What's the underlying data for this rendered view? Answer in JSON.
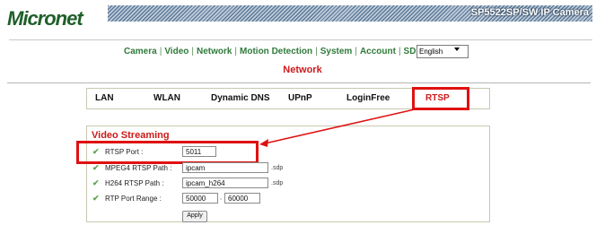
{
  "header": {
    "logo_text": "Micronet",
    "product_title": "SP5522SP/SW IP Camera"
  },
  "nav": {
    "items": [
      "Camera",
      "Video",
      "Network",
      "Motion Detection",
      "System",
      "Account",
      "SDHC"
    ],
    "separator": "|",
    "language_value": "English"
  },
  "page_title": "Network",
  "tabs": {
    "items": [
      "LAN",
      "WLAN",
      "Dynamic DNS",
      "UPnP",
      "LoginFree",
      "RTSP"
    ],
    "active": "RTSP"
  },
  "section": {
    "title": "Video Streaming",
    "rtsp_port_label": "RTSP Port :",
    "rtsp_port_value": "5011",
    "mpeg4_label": "MPEG4 RTSP Path :",
    "mpeg4_value": "ipcam",
    "mpeg4_suffix": ".sdp",
    "h264_label": "H264 RTSP Path :",
    "h264_value": "ipcam_h264",
    "h264_suffix": ".sdp",
    "rtp_range_label": "RTP Port Range :",
    "rtp_range_from": "50000",
    "rtp_range_sep": ",",
    "rtp_range_to": "60000",
    "apply_label": "Apply"
  },
  "colors": {
    "brand_green": "#1f5f2a",
    "nav_green": "#2f7a3a",
    "title_red": "#cc1a1a",
    "highlight_red": "#e01010",
    "check_green": "#5aa64c"
  },
  "icons": {
    "row_marker": "check-icon",
    "select_arrow": "chevron-down-icon",
    "annotation": "arrow-icon"
  }
}
